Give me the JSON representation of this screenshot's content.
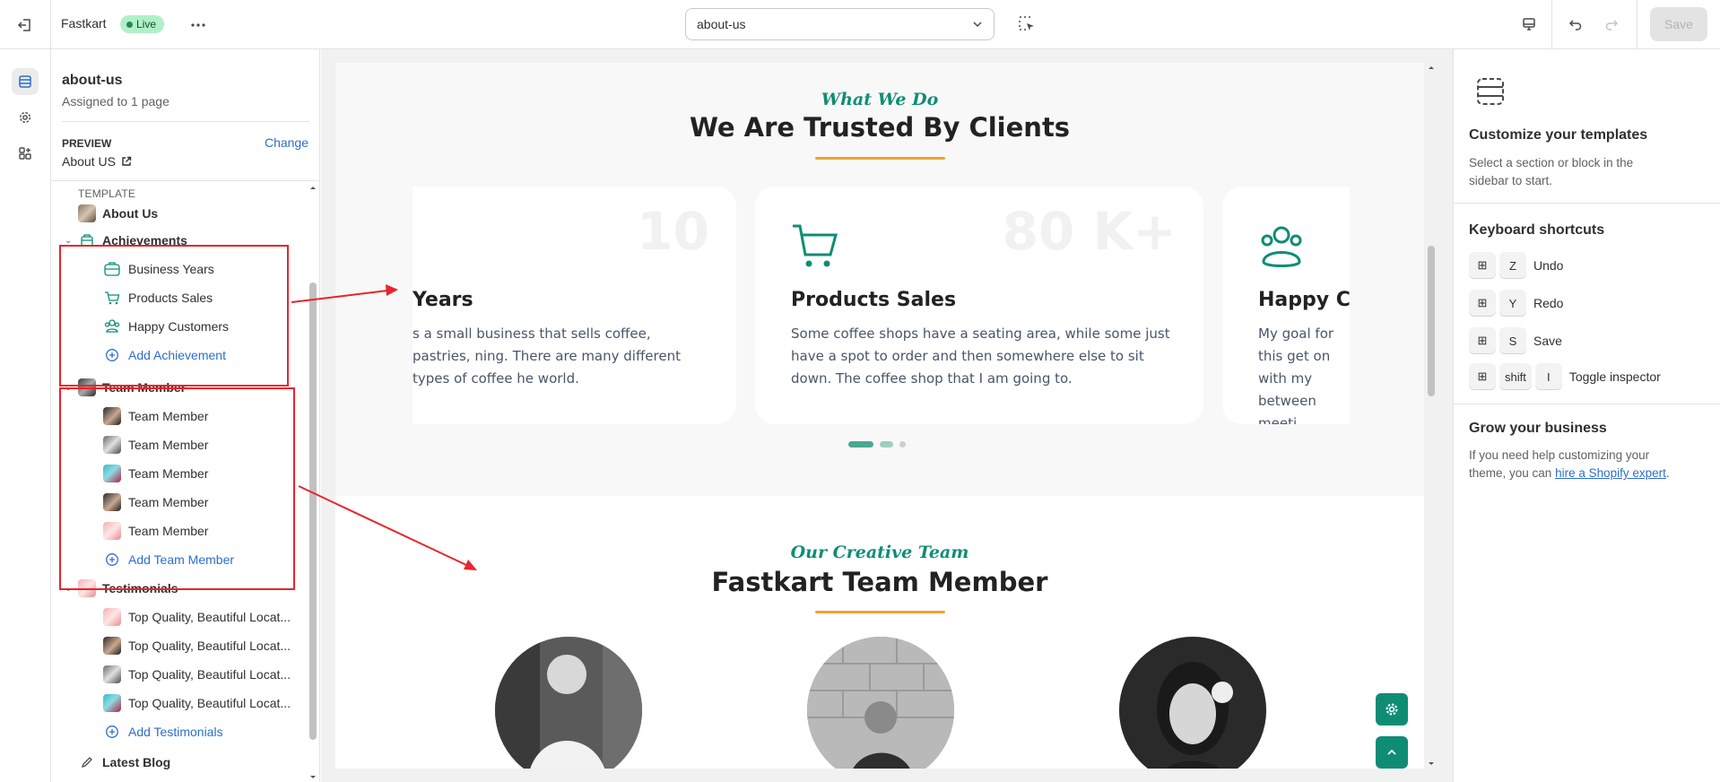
{
  "topbar": {
    "title": "Fastkart",
    "live_label": "Live",
    "template_select": "about-us",
    "save_label": "Save"
  },
  "left_panel": {
    "template_name": "about-us",
    "assigned": "Assigned to 1 page",
    "preview_label": "PREVIEW",
    "change_label": "Change",
    "preview_value": "About US",
    "tree_label": "TEMPLATE",
    "template_root": "About Us",
    "achievements": {
      "title": "Achievements",
      "items": [
        "Business Years",
        "Products Sales",
        "Happy Customers"
      ],
      "add": "Add Achievement"
    },
    "team": {
      "title": "Team Member",
      "items": [
        "Team Member",
        "Team Member",
        "Team Member",
        "Team Member",
        "Team Member"
      ],
      "add": "Add Team Member"
    },
    "testimonials": {
      "title": "Testimonials",
      "items": [
        "Top Quality, Beautiful Locat...",
        "Top Quality, Beautiful Locat...",
        "Top Quality, Beautiful Locat...",
        "Top Quality, Beautiful Locat..."
      ],
      "add": "Add Testimonials"
    },
    "latest_blog": "Latest Blog"
  },
  "preview": {
    "section1_script": "What We Do",
    "section1_title": "We Are Trusted By Clients",
    "cards": [
      {
        "number": "10",
        "title": "Years",
        "desc": "s a small business that sells coffee, pastries, ning. There are many different types of coffee he world."
      },
      {
        "number": "80 K+",
        "title": "Products Sales",
        "desc": "Some coffee shops have a seating area, while some just have a spot to order and then somewhere else to sit down. The coffee shop that I am going to."
      },
      {
        "number": "",
        "title": "Happy Cu",
        "desc": "My goal for this get on with my between meeti"
      }
    ],
    "section2_script": "Our Creative Team",
    "section2_title": "Fastkart Team Member"
  },
  "right_panel": {
    "customize_title": "Customize your templates",
    "customize_desc": "Select a section or block in the sidebar to start.",
    "shortcuts_title": "Keyboard shortcuts",
    "shortcuts": [
      {
        "keys": [
          "⊞",
          "Z"
        ],
        "label": "Undo"
      },
      {
        "keys": [
          "⊞",
          "Y"
        ],
        "label": "Redo"
      },
      {
        "keys": [
          "⊞",
          "S"
        ],
        "label": "Save"
      },
      {
        "keys": [
          "⊞",
          "shift",
          "I"
        ],
        "label": "Toggle inspector"
      }
    ],
    "grow_title": "Grow your business",
    "grow_text": "If you need help customizing your theme, you can ",
    "grow_link": "hire a Shopify expert",
    "grow_end": "."
  },
  "colors": {
    "accent": "#0f8d74",
    "underline": "#f0a134",
    "annotation": "#e8242c",
    "link": "#2c6ecb"
  }
}
